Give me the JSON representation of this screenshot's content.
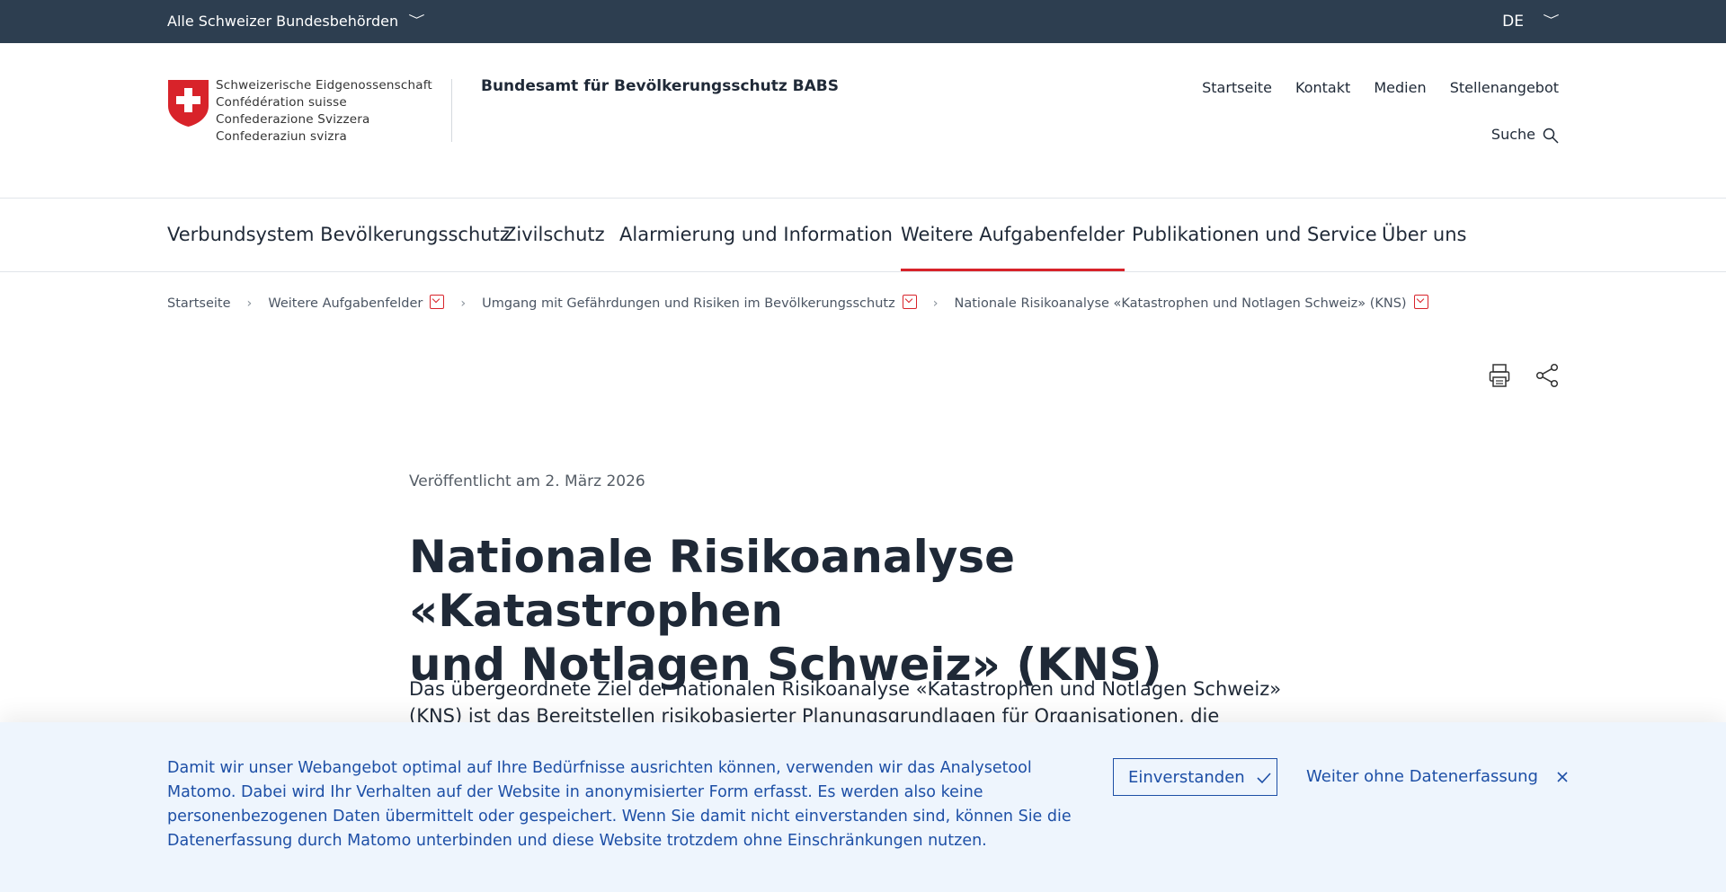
{
  "topbar": {
    "authorities_label": "Alle Schweizer Bundesbehörden",
    "language": "DE"
  },
  "header": {
    "confederation_lines": [
      "Schweizerische Eidgenossenschaft",
      "Confédération suisse",
      "Confederazione Svizzera",
      "Confederaziun svizra"
    ],
    "office_name": "Bundesamt für Bevölkerungsschutz BABS",
    "meta_nav": [
      "Startseite",
      "Kontakt",
      "Medien",
      "Stellenangebot"
    ],
    "search_label": "Suche"
  },
  "main_nav": {
    "items": [
      "Verbundsystem Bevölkerungsschutz",
      "Zivilschutz",
      "Alarmierung und Information",
      "Weitere Aufgabenfelder",
      "Publikationen und Service",
      "Über uns"
    ],
    "active_item": "Weitere Aufgabenfelder"
  },
  "breadcrumb": {
    "items": [
      "Startseite",
      "Weitere Aufgabenfelder",
      "Umgang mit Gefährdungen und Risiken im Bevölkerungsschutz",
      "Nationale Risikoanalyse «Katastrophen und Notlagen Schweiz» (KNS)"
    ]
  },
  "article": {
    "published": "Veröffentlicht am 2. März 2026",
    "title_line1": "Nationale Risikoanalyse «Katastrophen",
    "title_line2": "und Notlagen Schweiz» (KNS)",
    "lead_line1": "Das übergeordnete Ziel der nationalen Risikoanalyse «Katastrophen und Notlagen Schweiz»",
    "lead_line2": "(KNS) ist das Bereitstellen risikobasierter Planungsgrundlagen für Organisationen, die"
  },
  "cookie_banner": {
    "message": "Damit wir unser Webangebot optimal auf Ihre Bedürfnisse ausrichten können, verwenden wir das Analysetool Matomo. Dabei wird Ihr Verhalten auf der Website in anonymisierter Form erfasst. Es werden also keine personenbezogenen Daten übermittelt oder gespeichert. Wenn Sie damit nicht einverstanden sind, können Sie die Datenerfassung durch Matomo unterbinden und diese Website trotzdem ohne Einschränkungen nutzen.",
    "accept_label": "Einverstanden",
    "decline_label": "Weiter ohne Datenerfassung"
  },
  "colors": {
    "topbar_bg": "#2d3e50",
    "accent_red": "#d8232a",
    "cookie_bg": "#eef5fd",
    "cookie_text": "#1d4fa6"
  },
  "icons": [
    "chevron-down-icon",
    "swiss-cross-logo",
    "search-icon",
    "print-icon",
    "share-icon",
    "check-icon",
    "close-icon"
  ]
}
